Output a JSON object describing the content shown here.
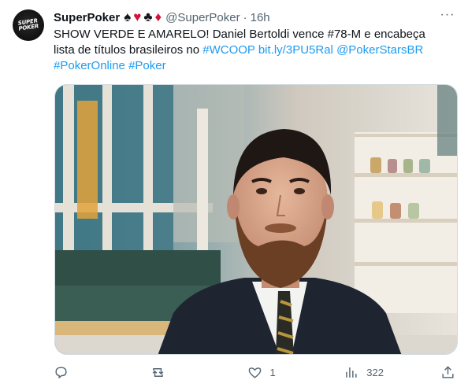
{
  "tweet": {
    "author_name": "SuperPoker",
    "suits": [
      {
        "glyph": "♠",
        "color": "black"
      },
      {
        "glyph": "♥",
        "color": "red"
      },
      {
        "glyph": "♣",
        "color": "black"
      },
      {
        "glyph": "♦",
        "color": "red"
      }
    ],
    "handle": "@SuperPoker",
    "separator": "·",
    "time": "16h",
    "avatar_text_line1": "SUPER",
    "avatar_text_line2": "POKER",
    "text_plain": "SHOW VERDE E AMARELO! Daniel Bertoldi vence #78-M e encabeça lista de títulos brasileiros no ",
    "links": [
      "#WCOOP",
      "bit.ly/3PU5Ral",
      "@PokerStarsBR",
      "#PokerOnline",
      "#Poker"
    ]
  },
  "actions": {
    "reply_count": "",
    "retweet_count": "",
    "like_count": "1",
    "views_count": "322"
  },
  "colors": {
    "link": "#1d9bf0",
    "muted": "#536471",
    "suit_red": "#d0143a"
  }
}
